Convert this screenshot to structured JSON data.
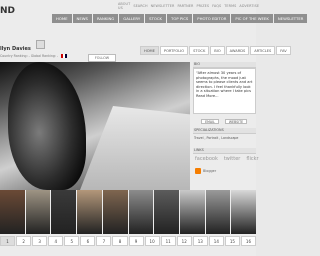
{
  "header": {
    "logo_text": "ND",
    "util_links": [
      "ABOUT US",
      "SEARCH",
      "NEWSLETTER",
      "PARTNER",
      "PRIZES",
      "FAQS",
      "TERMS",
      "ADVERTISE"
    ],
    "nav": [
      {
        "label": "HOME"
      },
      {
        "label": "NEWS"
      },
      {
        "label": "RANKING"
      },
      {
        "label": "GALLERY"
      },
      {
        "label": "STOCK"
      },
      {
        "label": "TOP PICS"
      },
      {
        "label": "PHOTO EDITOR"
      },
      {
        "label": "PIC OF THE WEEK"
      },
      {
        "label": "NEWSLETTER"
      }
    ]
  },
  "profile": {
    "name": "llyn Davies",
    "country_ranking": "Country Ranking: -",
    "global_ranking": "Global Ranking: -",
    "follow_label": "FOLLOW"
  },
  "subnav": [
    {
      "label": "HOME"
    },
    {
      "label": "PORTFOLIO"
    },
    {
      "label": "STOCK"
    },
    {
      "label": "BIO"
    },
    {
      "label": "AWARDS"
    },
    {
      "label": "ARTICLES"
    },
    {
      "label": "FAV"
    }
  ],
  "sidebar": {
    "bio_label": "BIO",
    "quote": "\"After almost 30 years of photographs, the mood just seems to please clients and art direction. I feel thankfully look in a situation where I take pics Read More...",
    "email_label": "EMAIL",
    "website_label": "WEBSITE",
    "spec_label": "SPECIALIZATIONS",
    "spec_value": "Travel , Portrait , Landscape",
    "links_label": "LINKS",
    "social": [
      "facebook",
      "twitter",
      "flickr"
    ],
    "blogger_label": "Blogger"
  },
  "thumbnails": [
    {
      "tone": "#6b4a36"
    },
    {
      "tone": "#9e9484"
    },
    {
      "tone": "#3a3a3a"
    },
    {
      "tone": "#b3977a"
    },
    {
      "tone": "#7f6650"
    },
    {
      "tone": "#8c8c8c"
    },
    {
      "tone": "#5c5c5c"
    },
    {
      "tone": "#c9c9c9"
    },
    {
      "tone": "#9a9a9a"
    },
    {
      "tone": "#d9d9d9"
    }
  ],
  "pager": [
    "1",
    "2",
    "3",
    "4",
    "5",
    "6",
    "7",
    "8",
    "9",
    "10",
    "11",
    "12",
    "13",
    "14",
    "15",
    "16"
  ]
}
